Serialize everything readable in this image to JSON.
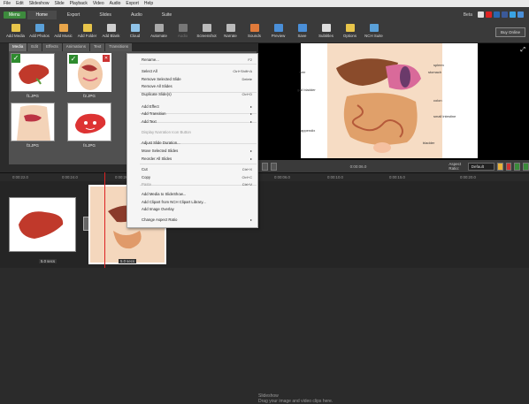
{
  "menubar": [
    "File",
    "Edit",
    "Slideshow",
    "Slide",
    "Playback",
    "Video",
    "Audio",
    "Export",
    "Help"
  ],
  "tabs": {
    "menu": "Menu",
    "items": [
      "Home",
      "Export",
      "Slides",
      "Audio",
      "Suite"
    ],
    "active": 0,
    "beta": "Beta"
  },
  "toolbar": [
    {
      "label": "Add Media",
      "icon": "add-media-icon",
      "color": "#e8c54a"
    },
    {
      "label": "Add Photos",
      "icon": "add-photos-icon",
      "color": "#5aa0d8"
    },
    {
      "label": "Add Music",
      "icon": "add-music-icon",
      "color": "#e8a54a"
    },
    {
      "label": "Add Folder",
      "icon": "add-folder-icon",
      "color": "#e8c54a"
    },
    {
      "label": "Add Blank",
      "icon": "add-blank-icon",
      "color": "#cfcfcf"
    },
    {
      "label": "Cloud",
      "icon": "cloud-icon",
      "color": "#8fc3e8"
    },
    {
      "label": "Automate",
      "icon": "automate-icon",
      "color": "#aaaaaa"
    },
    {
      "label": "Audio",
      "icon": "audio-icon",
      "color": "#777777",
      "disabled": true
    },
    {
      "label": "Screenshot",
      "icon": "screenshot-icon",
      "color": "#bbbbbb"
    },
    {
      "label": "Narrate",
      "icon": "narrate-icon",
      "color": "#bbbbbb"
    },
    {
      "label": "Sounds",
      "icon": "sounds-icon",
      "color": "#e07a3a"
    },
    {
      "label": "Preview",
      "icon": "preview-icon",
      "color": "#4a8fd8"
    },
    {
      "label": "Save",
      "icon": "save-icon",
      "color": "#4a8fd8"
    },
    {
      "label": "Subtitles",
      "icon": "subtitles-icon",
      "color": "#dddddd"
    },
    {
      "label": "Options",
      "icon": "options-icon",
      "color": "#e8c54a"
    },
    {
      "label": "NCH Suite",
      "icon": "nch-suite-icon",
      "color": "#5aa0d8"
    }
  ],
  "buy_online": "Buy Online",
  "left_tabs": [
    "Media",
    "Edit",
    "Effects",
    "Animations",
    "Text",
    "Transitions"
  ],
  "media_items": [
    "f1.JPG",
    "f2.JPG",
    "f3.JPG",
    "f4.JPG"
  ],
  "context_menu": [
    {
      "label": "Rename...",
      "shortcut": "F2"
    },
    {
      "label": "Select All",
      "shortcut": "Ctrl+Shift+A"
    },
    {
      "label": "Remove Selected Slide",
      "shortcut": "Delete"
    },
    {
      "label": "Remove All Slides",
      "shortcut": ""
    },
    {
      "label": "Duplicate Slide(s)",
      "shortcut": "Ctrl+D"
    },
    {
      "label": "Add Effect",
      "shortcut": "▸"
    },
    {
      "label": "Add Transition",
      "shortcut": "▸"
    },
    {
      "label": "Add Text",
      "shortcut": "▸"
    },
    {
      "label": "Display Narration Icon Button",
      "shortcut": "",
      "disabled": true
    },
    {
      "label": "Adjust Slide Duration...",
      "shortcut": ""
    },
    {
      "label": "Move Selected Slides",
      "shortcut": "▸"
    },
    {
      "label": "Reorder All Slides",
      "shortcut": "▸"
    },
    {
      "label": "Cut",
      "shortcut": "Ctrl+X"
    },
    {
      "label": "Copy",
      "shortcut": "Ctrl+C"
    },
    {
      "label": "Paste",
      "shortcut": "Ctrl+V",
      "disabled": true
    },
    {
      "label": "Add Media to SlideShow...",
      "shortcut": ""
    },
    {
      "label": "Add Clipart from NCH Clipart Library...",
      "shortcut": ""
    },
    {
      "label": "Add Image Overlay",
      "shortcut": ""
    },
    {
      "label": "Change Aspect Ratio",
      "shortcut": "▸"
    }
  ],
  "preview_labels": [
    "liver",
    "gall bladder",
    "stomach",
    "spleen",
    "colon",
    "small intestine",
    "appendix",
    "bladder"
  ],
  "controls": {
    "time": "0:00:06.0",
    "aspect_label": "Aspect Ratio:",
    "aspect_value": "Default"
  },
  "ruler": [
    "0:00:22.0",
    "0:00:24.0",
    "0:00:26.0",
    "0:00:28.0",
    "0:00:30.0",
    "0:00:06.0",
    "0:00:10.0",
    "0:00:15.0",
    "0:00:20.0"
  ],
  "timeline": {
    "clip1_duration": "5.0 secs",
    "clip2_duration": "5.0 secs",
    "slideshow_title": "Slideshow",
    "slideshow_hint": "Drag your image and video clips here."
  }
}
